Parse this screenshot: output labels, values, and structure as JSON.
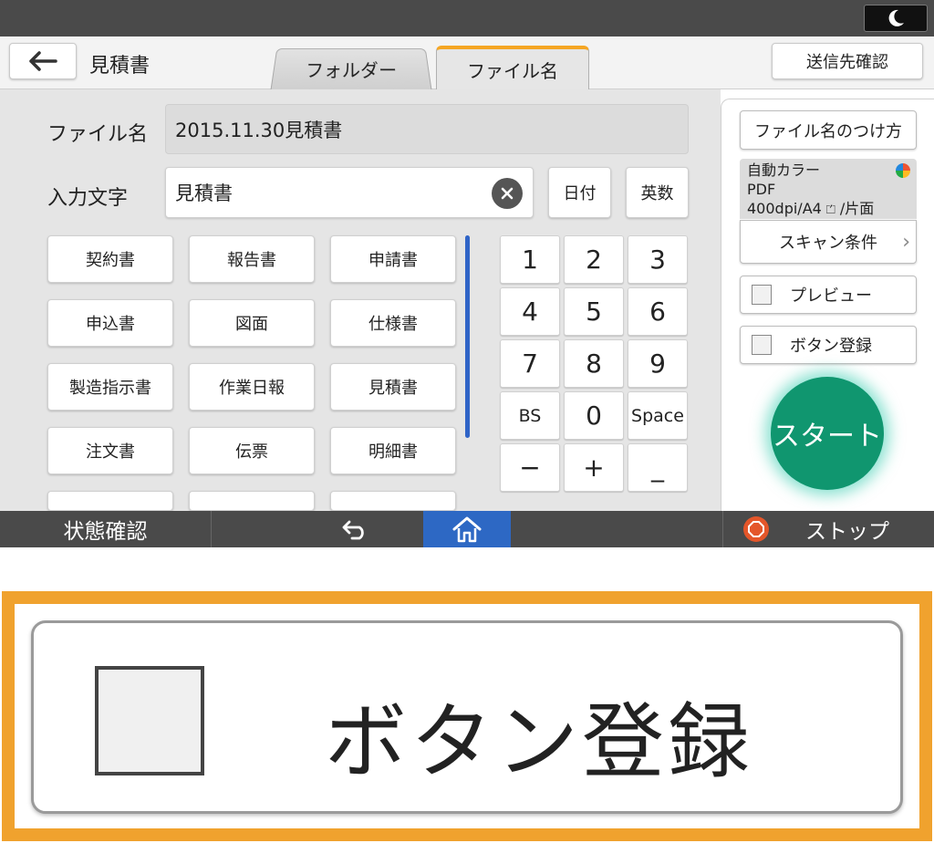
{
  "header": {
    "title": "見積書",
    "tabs": [
      {
        "label": "フォルダー",
        "active": false
      },
      {
        "label": "ファイル名",
        "active": true
      }
    ],
    "confirm_destination": "送信先確認"
  },
  "form": {
    "filename_label": "ファイル名",
    "filename_value": "2015.11.30見積書",
    "input_label": "入力文字",
    "input_value": "見積書",
    "date_button": "日付",
    "alnum_button": "英数"
  },
  "words": {
    "rows": [
      [
        "契約書",
        "報告書",
        "申請書"
      ],
      [
        "申込書",
        "図面",
        "仕様書"
      ],
      [
        "製造指示書",
        "作業日報",
        "見積書"
      ],
      [
        "注文書",
        "伝票",
        "明細書"
      ]
    ]
  },
  "keypad": {
    "keys": [
      "1",
      "2",
      "3",
      "4",
      "5",
      "6",
      "7",
      "8",
      "9",
      "BS",
      "0",
      "Space",
      "−",
      "+",
      "_"
    ]
  },
  "side": {
    "naming_button": "ファイル名のつけ方",
    "info_color": "自動カラー",
    "info_format": "PDF",
    "info_resolution": "400dpi/A4",
    "info_sides": "/片面",
    "scan_conditions": "スキャン条件",
    "preview": "プレビュー",
    "button_register": "ボタン登録",
    "start": "スタート"
  },
  "bottom": {
    "status": "状態確認",
    "stop": "ストップ"
  },
  "zoom": {
    "label": "ボタン登録"
  },
  "colors": {
    "accent_tab": "#f5a623",
    "start": "#10966f",
    "home": "#2d68c4",
    "stop": "#e4562a",
    "highlight_frame": "#f0a22e"
  }
}
